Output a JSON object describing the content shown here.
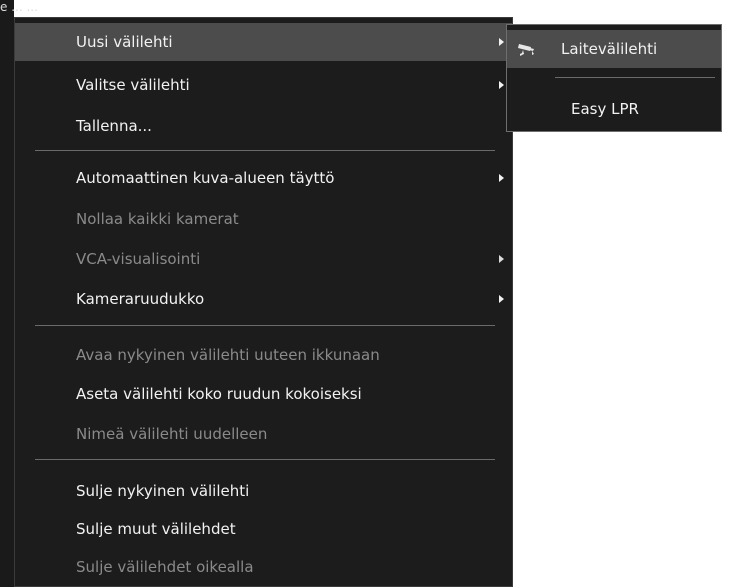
{
  "window": {
    "title_fragment": "e ... ..."
  },
  "context_menu": {
    "items": [
      {
        "label": "Uusi välilehti",
        "has_submenu": true,
        "enabled": true,
        "highlighted": true
      },
      {
        "label": "Valitse välilehti",
        "has_submenu": true,
        "enabled": true,
        "highlighted": false
      },
      {
        "label": "Tallenna...",
        "has_submenu": false,
        "enabled": true,
        "highlighted": false
      },
      {
        "label": "Automaattinen kuva-alueen täyttö",
        "has_submenu": true,
        "enabled": true,
        "highlighted": false
      },
      {
        "label": "Nollaa kaikki kamerat",
        "has_submenu": false,
        "enabled": false,
        "highlighted": false
      },
      {
        "label": "VCA-visualisointi",
        "has_submenu": true,
        "enabled": false,
        "highlighted": false
      },
      {
        "label": "Kameraruudukko",
        "has_submenu": true,
        "enabled": true,
        "highlighted": false
      },
      {
        "label": "Avaa nykyinen välilehti uuteen ikkunaan",
        "has_submenu": false,
        "enabled": false,
        "highlighted": false
      },
      {
        "label": "Aseta välilehti koko ruudun kokoiseksi",
        "has_submenu": false,
        "enabled": true,
        "highlighted": false
      },
      {
        "label": "Nimeä välilehti uudelleen",
        "has_submenu": false,
        "enabled": false,
        "highlighted": false
      },
      {
        "label": "Sulje nykyinen välilehti",
        "has_submenu": false,
        "enabled": true,
        "highlighted": false
      },
      {
        "label": "Sulje muut välilehdet",
        "has_submenu": false,
        "enabled": true,
        "highlighted": false
      },
      {
        "label": "Sulje välilehdet oikealla",
        "has_submenu": false,
        "enabled": false,
        "highlighted": false
      }
    ]
  },
  "submenu": {
    "items": [
      {
        "label": "Laitevälilehti",
        "icon": "security-camera-icon",
        "highlighted": true
      },
      {
        "label": "Easy LPR",
        "icon": "",
        "highlighted": false
      }
    ]
  },
  "colors": {
    "menu_background": "#1c1c1c",
    "highlight_background": "#4c4c4c",
    "enabled_text": "#f2f2f2",
    "disabled_text": "#8a8a8a",
    "separator": "#6a6a6a"
  }
}
